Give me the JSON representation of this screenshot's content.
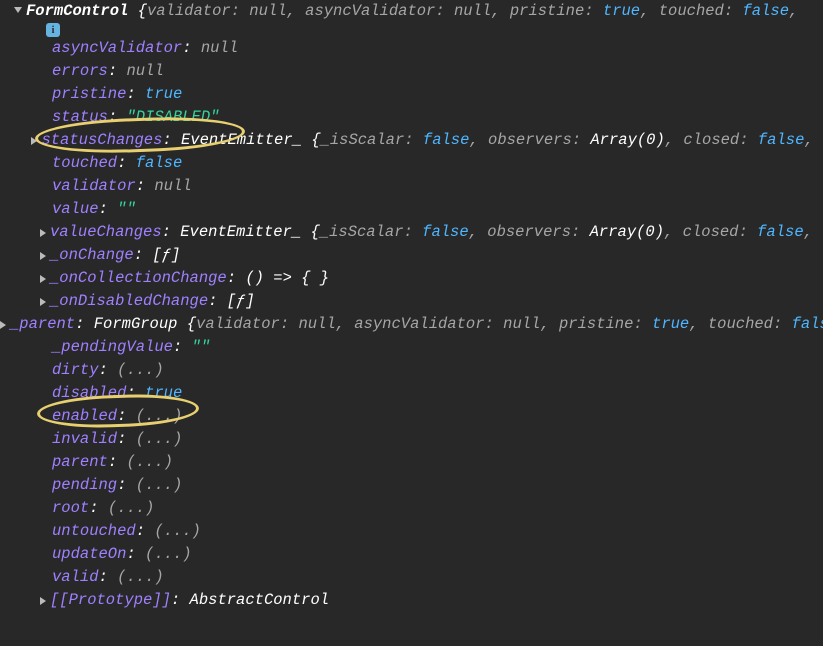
{
  "header": {
    "className": "FormControl",
    "brace": "{",
    "props": [
      {
        "k": "validator",
        "t": "null",
        "v": "null"
      },
      {
        "k": "asyncValidator",
        "t": "null",
        "v": "null"
      },
      {
        "k": "pristine",
        "t": "bool",
        "v": "true"
      },
      {
        "k": "touched",
        "t": "bool",
        "v": "false"
      }
    ]
  },
  "infoBadge": "i",
  "props": [
    {
      "key": "asyncValidator",
      "val": "null",
      "type": "null",
      "expand": null
    },
    {
      "key": "errors",
      "val": "null",
      "type": "null",
      "expand": null
    },
    {
      "key": "pristine",
      "val": "true",
      "type": "bool",
      "expand": null
    },
    {
      "key": "status",
      "val": "\"DISABLED\"",
      "type": "str",
      "expand": null
    },
    {
      "key": "statusChanges",
      "expand": "closed",
      "inline": {
        "cls": "EventEmitter_",
        "props": [
          {
            "k": "_isScalar",
            "t": "bool",
            "v": "false"
          },
          {
            "k": "observers",
            "t": "white",
            "v": "Array(0)"
          },
          {
            "k": "closed",
            "t": "bool",
            "v": "false"
          }
        ]
      }
    },
    {
      "key": "touched",
      "val": "false",
      "type": "bool",
      "expand": null
    },
    {
      "key": "validator",
      "val": "null",
      "type": "null",
      "expand": null
    },
    {
      "key": "value",
      "val": "\"\"",
      "type": "str",
      "expand": null
    },
    {
      "key": "valueChanges",
      "expand": "closed",
      "inline": {
        "cls": "EventEmitter_",
        "props": [
          {
            "k": "_isScalar",
            "t": "bool",
            "v": "false"
          },
          {
            "k": "observers",
            "t": "white",
            "v": "Array(0)"
          },
          {
            "k": "closed",
            "t": "bool",
            "v": "false"
          }
        ]
      }
    },
    {
      "key": "_onChange",
      "val": "[ƒ]",
      "type": "white",
      "expand": "closed"
    },
    {
      "key": "_onCollectionChange",
      "val": "() => { }",
      "type": "fn",
      "expand": "closed"
    },
    {
      "key": "_onDisabledChange",
      "val": "[ƒ]",
      "type": "white",
      "expand": "closed"
    },
    {
      "key": "_parent",
      "expand": "closed",
      "inline": {
        "cls": "FormGroup",
        "props": [
          {
            "k": "validator",
            "t": "null",
            "v": "null"
          },
          {
            "k": "asyncValidator",
            "t": "null",
            "v": "null"
          },
          {
            "k": "pristine",
            "t": "bool",
            "v": "true"
          },
          {
            "k": "touched",
            "t": "bool",
            "v": "false"
          }
        ]
      }
    },
    {
      "key": "_pendingValue",
      "val": "\"\"",
      "type": "str",
      "expand": null
    },
    {
      "key": "dirty",
      "val": "(...)",
      "type": "grey",
      "expand": null
    },
    {
      "key": "disabled",
      "val": "true",
      "type": "bool",
      "expand": null
    },
    {
      "key": "enabled",
      "val": "(...)",
      "type": "grey",
      "expand": null
    },
    {
      "key": "invalid",
      "val": "(...)",
      "type": "grey",
      "expand": null
    },
    {
      "key": "parent",
      "val": "(...)",
      "type": "grey",
      "expand": null
    },
    {
      "key": "pending",
      "val": "(...)",
      "type": "grey",
      "expand": null
    },
    {
      "key": "root",
      "val": "(...)",
      "type": "grey",
      "expand": null
    },
    {
      "key": "untouched",
      "val": "(...)",
      "type": "grey",
      "expand": null
    },
    {
      "key": "updateOn",
      "val": "(...)",
      "type": "grey",
      "expand": null
    },
    {
      "key": "valid",
      "val": "(...)",
      "type": "grey",
      "expand": null
    },
    {
      "key": "[[Prototype]]",
      "val": "AbstractControl",
      "type": "white",
      "expand": "closed",
      "proto": true
    }
  ]
}
